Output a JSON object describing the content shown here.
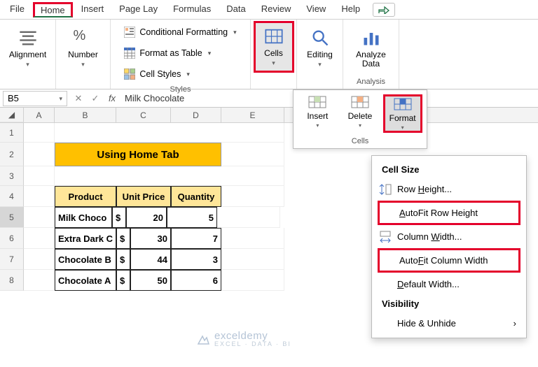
{
  "menu": {
    "file": "File",
    "home": "Home",
    "insert": "Insert",
    "pagelay": "Page Lay",
    "formulas": "Formulas",
    "data": "Data",
    "review": "Review",
    "view": "View",
    "help": "Help"
  },
  "ribbon": {
    "alignment": {
      "label": "Alignment"
    },
    "number": {
      "label": "Number",
      "pct": "%"
    },
    "styles": {
      "cond": "Conditional Formatting",
      "table": "Format as Table",
      "cell": "Cell Styles",
      "label": "Styles"
    },
    "cells": {
      "label": "Cells"
    },
    "editing": {
      "label": "Editing"
    },
    "analysis": {
      "btn": "Analyze Data",
      "label": "Analysis"
    }
  },
  "namebox": "B5",
  "formula": "Milk Chocolate",
  "sheet": {
    "cols": [
      "A",
      "B",
      "C",
      "D",
      "E"
    ],
    "title": "Using Home Tab",
    "headers": {
      "product": "Product",
      "unitprice": "Unit Price",
      "quantity": "Quantity"
    },
    "rows": [
      {
        "product": "Milk Choco",
        "cur": "$",
        "price": "20",
        "qty": "5"
      },
      {
        "product": "Extra Dark C",
        "cur": "$",
        "price": "30",
        "qty": "7"
      },
      {
        "product": "Chocolate B",
        "cur": "$",
        "price": "44",
        "qty": "3"
      },
      {
        "product": "Chocolate A",
        "cur": "$",
        "price": "50",
        "qty": "6"
      }
    ]
  },
  "cellsPanel": {
    "insert": "Insert",
    "delete": "Delete",
    "format": "Format",
    "label": "Cells"
  },
  "formatMenu": {
    "sec1": "Cell Size",
    "rowh": "Row Height...",
    "afrow": "AutoFit Row Height",
    "colw": "Column Width...",
    "afcol": "AutoFit Column Width",
    "defw": "Default Width...",
    "sec2": "Visibility",
    "hide": "Hide & Unhide"
  },
  "watermark": {
    "name": "exceldemy",
    "tag": "EXCEL · DATA · BI"
  }
}
